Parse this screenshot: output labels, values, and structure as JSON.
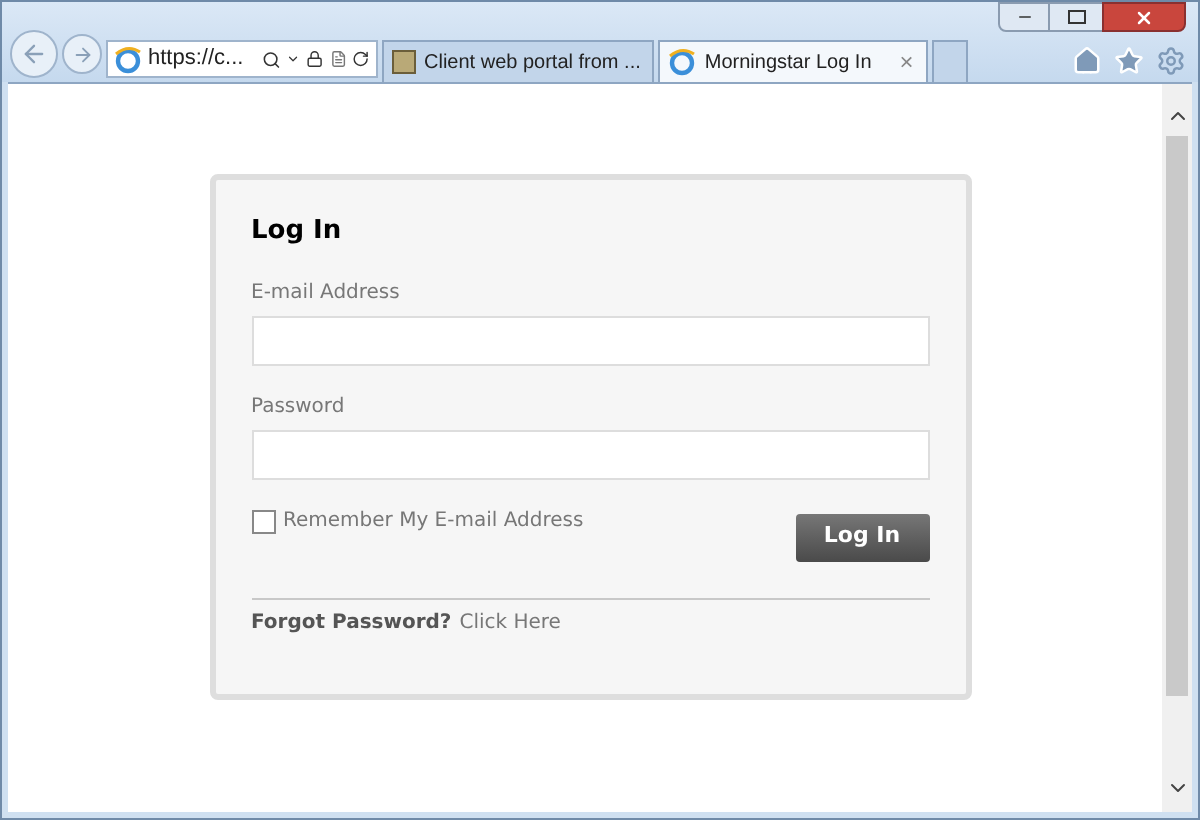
{
  "browser": {
    "address": "https://c...",
    "tabs": [
      {
        "label": "Client web portal from ...",
        "selected": false,
        "kind": "page"
      },
      {
        "label": "Morningstar Log In",
        "selected": true,
        "kind": "ie"
      }
    ],
    "close_tab": "×"
  },
  "login": {
    "title": "Log In",
    "email_label": "E-mail Address",
    "password_label": "Password",
    "remember": {
      "label": "Remember My E-mail Address",
      "checked": false
    },
    "button": "Log In",
    "forgot": "Forgot Password?",
    "link": "Click Here"
  }
}
